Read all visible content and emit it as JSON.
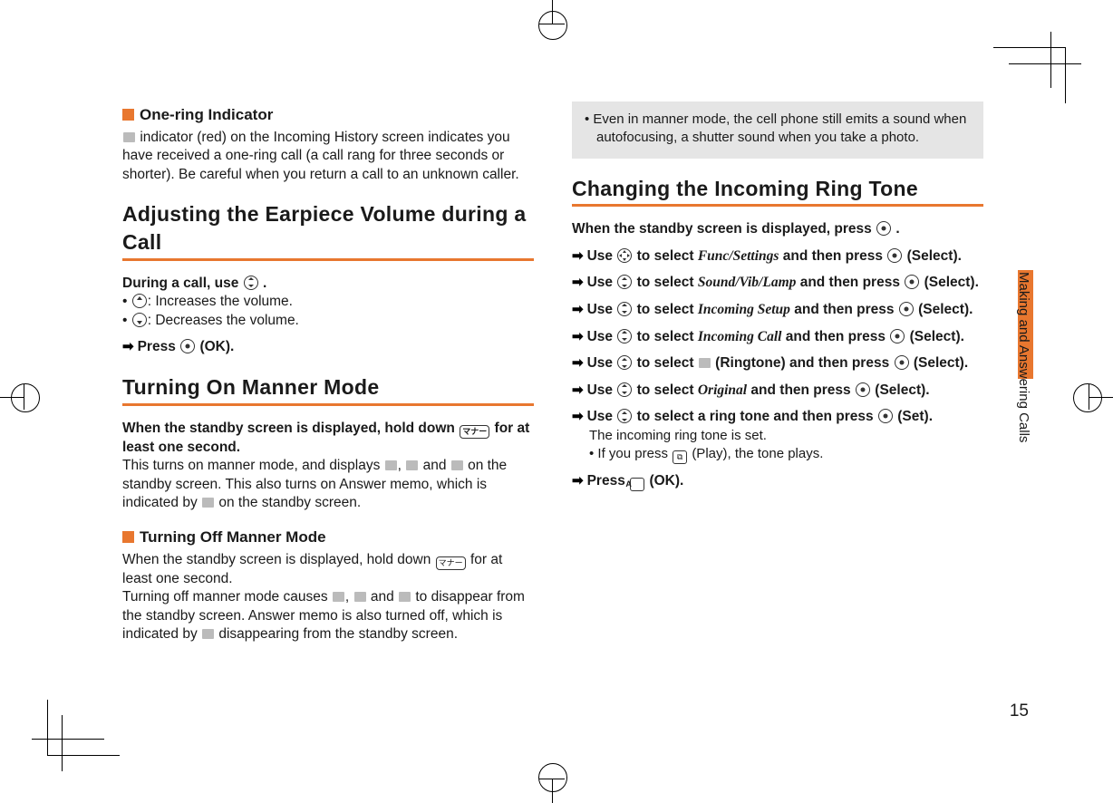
{
  "page_number": "15",
  "side_label": "Making and Answering Calls",
  "left": {
    "sec1_title": "One-ring Indicator",
    "sec1_body": "indicator (red) on the Incoming History screen indicates you have received a one-ring call (a call rang for three seconds or shorter). Be careful when you return a call to an unknown caller.",
    "h_adjust": "Adjusting the Earpiece Volume during a Call",
    "adjust_lead": "During a call, use",
    "adjust_inc": ": Increases the volume.",
    "adjust_dec": ": Decreases the volume.",
    "adjust_ok": "Press",
    "adjust_ok_suffix": "(OK).",
    "h_manner": "Turning On Manner Mode",
    "manner_lead1": "When the standby screen is displayed, hold down",
    "manner_lead2": "for at least one second.",
    "manner_body_a": "This turns on manner mode, and displays",
    "manner_body_b": "and",
    "manner_body_c": "on the standby screen. This also turns on Answer memo, which is indicated by",
    "manner_body_d": "on the standby screen.",
    "sec_off_title": "Turning Off Manner Mode",
    "off_body_a": "When the standby screen is displayed, hold down",
    "off_body_b": "for at least one second.",
    "off_body_c": "Turning off manner mode causes ",
    "off_body_d": "and",
    "off_body_e": "to disappear from the standby screen. Answer memo is also turned off, which is indicated by",
    "off_body_f": "disappearing from the standby screen."
  },
  "right": {
    "note": "Even in manner mode, the cell phone still emits a sound when autofocusing, a shutter sound when you take a photo.",
    "h_change": "Changing the Incoming Ring Tone",
    "lead": "When the standby screen is displayed, press",
    "use": "Use",
    "to_select": "to select",
    "and_press": "and then press",
    "select_suffix": "(Select).",
    "set_suffix": "(Set).",
    "m1": "Func/Settings",
    "m2": "Sound/Vib/Lamp",
    "m3": "Incoming Setup",
    "m4": "Incoming Call",
    "m5_label": "(Ringtone)",
    "m6": "Original",
    "step7": "to select a ring tone and then press",
    "after7a": "The incoming ring tone is set.",
    "after7b": "If you press",
    "after7c": "(Play), the tone plays.",
    "final": "Press",
    "final_suffix": "(OK)."
  }
}
